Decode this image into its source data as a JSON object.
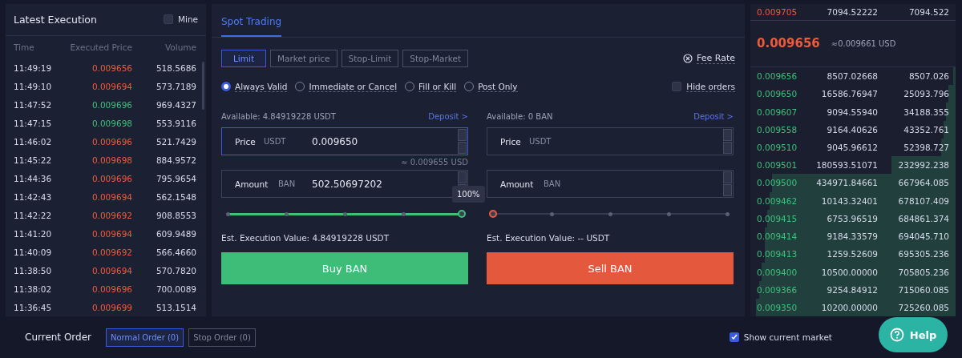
{
  "executions": {
    "title": "Latest Execution",
    "mine": {
      "label": "Mine",
      "checked": false
    },
    "columns": [
      "Time",
      "Executed Price",
      "Volume"
    ],
    "rows": [
      {
        "time": "11:49:19",
        "price": "0.009656",
        "volume": "518.5686",
        "color": "#ef5b3a"
      },
      {
        "time": "11:49:10",
        "price": "0.009694",
        "volume": "573.7189",
        "color": "#ef5b3a"
      },
      {
        "time": "11:47:52",
        "price": "0.009696",
        "volume": "969.4327",
        "color": "#3fc07a"
      },
      {
        "time": "11:47:15",
        "price": "0.009698",
        "volume": "553.9116",
        "color": "#3fc07a"
      },
      {
        "time": "11:46:02",
        "price": "0.009696",
        "volume": "521.7429",
        "color": "#ef5b3a"
      },
      {
        "time": "11:45:22",
        "price": "0.009698",
        "volume": "884.9572",
        "color": "#ef5b3a"
      },
      {
        "time": "11:44:36",
        "price": "0.009696",
        "volume": "795.9654",
        "color": "#ef5b3a"
      },
      {
        "time": "11:42:43",
        "price": "0.009694",
        "volume": "562.1548",
        "color": "#ef5b3a"
      },
      {
        "time": "11:42:22",
        "price": "0.009692",
        "volume": "908.8553",
        "color": "#ef5b3a"
      },
      {
        "time": "11:41:20",
        "price": "0.009694",
        "volume": "609.9489",
        "color": "#ef5b3a"
      },
      {
        "time": "11:40:09",
        "price": "0.009692",
        "volume": "566.4660",
        "color": "#ef5b3a"
      },
      {
        "time": "11:38:50",
        "price": "0.009694",
        "volume": "570.7820",
        "color": "#ef5b3a"
      },
      {
        "time": "11:38:02",
        "price": "0.009696",
        "volume": "700.0089",
        "color": "#ef5b3a"
      },
      {
        "time": "11:36:45",
        "price": "0.009699",
        "volume": "513.1514",
        "color": "#ef5b3a"
      }
    ]
  },
  "trading": {
    "tabs": [
      {
        "label": "Spot Trading",
        "selected": true
      }
    ],
    "order_types": [
      {
        "label": "Limit",
        "selected": true
      },
      {
        "label": "Market price",
        "selected": false
      },
      {
        "label": "Stop-Limit",
        "selected": false
      },
      {
        "label": "Stop-Market",
        "selected": false
      }
    ],
    "fee_rate": "Fee Rate",
    "validity": [
      {
        "label": "Always Valid",
        "selected": true
      },
      {
        "label": "Immediate or Cancel",
        "selected": false
      },
      {
        "label": "Fill or Kill",
        "selected": false
      },
      {
        "label": "Post Only",
        "selected": false
      }
    ],
    "hide_orders": {
      "label": "Hide orders",
      "checked": false
    },
    "forms": [
      {
        "kind": "buy",
        "available": "Available: 4.84919228 USDT",
        "deposit": "Deposit >",
        "price": {
          "label": "Price",
          "unit": "USDT",
          "value": "0.009650",
          "focused": true
        },
        "price_hint": "≈ 0.009655 USD",
        "amount": {
          "label": "Amount",
          "unit": "BAN",
          "value": "502.50697202"
        },
        "level": 1,
        "tooltip": "100%",
        "est": "Est. Execution Value: 4.84919228 USDT",
        "button": "Buy BAN"
      },
      {
        "kind": "sell",
        "available": "Available: 0 BAN",
        "deposit": "Deposit >",
        "price": {
          "label": "Price",
          "unit": "USDT",
          "focused": false
        },
        "amount": {
          "label": "Amount",
          "unit": "BAN"
        },
        "level": 0,
        "est": "Est. Execution Value: -- USDT",
        "button": "Sell BAN"
      }
    ]
  },
  "order_book": {
    "ask_rows": [
      {
        "price": "0.009705",
        "amount": "7094.52222",
        "total": "7094.522"
      }
    ],
    "last_price": "0.009656",
    "last_price_usd": "≈0.009661 USD",
    "bid_rows": [
      {
        "price": "0.009656",
        "amount": "8507.02668",
        "total": "8507.026"
      },
      {
        "price": "0.009650",
        "amount": "16586.76947",
        "total": "25093.796"
      },
      {
        "price": "0.009607",
        "amount": "9094.55940",
        "total": "34188.355"
      },
      {
        "price": "0.009558",
        "amount": "9164.40626",
        "total": "43352.761"
      },
      {
        "price": "0.009510",
        "amount": "9045.96612",
        "total": "52398.727"
      },
      {
        "price": "0.009501",
        "amount": "180593.51071",
        "total": "232992.238"
      },
      {
        "price": "0.009500",
        "amount": "434971.84661",
        "total": "667964.085"
      },
      {
        "price": "0.009462",
        "amount": "10143.32401",
        "total": "678107.409"
      },
      {
        "price": "0.009415",
        "amount": "6753.96519",
        "total": "684861.374"
      },
      {
        "price": "0.009414",
        "amount": "9184.33579",
        "total": "694045.710"
      },
      {
        "price": "0.009413",
        "amount": "1259.52609",
        "total": "695305.236"
      },
      {
        "price": "0.009400",
        "amount": "10500.00000",
        "total": "705805.236"
      },
      {
        "price": "0.009366",
        "amount": "9254.84912",
        "total": "715060.085"
      },
      {
        "price": "0.009350",
        "amount": "10200.00000",
        "total": "725260.085"
      }
    ]
  },
  "current_order": {
    "title": "Current Order",
    "tabs": [
      {
        "label": "Normal Order (0)",
        "selected": true
      },
      {
        "label": "Stop Order (0)",
        "selected": false
      }
    ],
    "show_current_market": {
      "label": "Show current market",
      "checked": true
    }
  },
  "help": "Help"
}
